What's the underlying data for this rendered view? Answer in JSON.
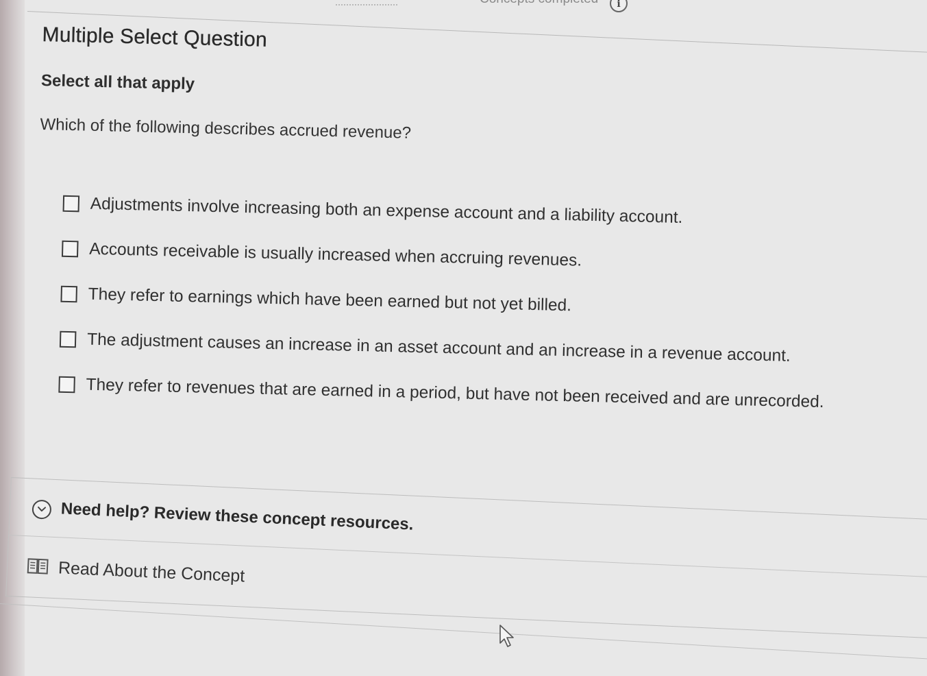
{
  "header": {
    "status_text": "Concepts completed",
    "info_label": "i"
  },
  "question": {
    "type_label": "Multiple Select Question",
    "instruction": "Select all that apply",
    "prompt": "Which of the following describes accrued revenue?",
    "options": [
      {
        "label": "Adjustments involve increasing both an expense account and a liability account.",
        "checked": false
      },
      {
        "label": "Accounts receivable is usually increased when accruing revenues.",
        "checked": false
      },
      {
        "label": "They refer to earnings which have been earned but not yet billed.",
        "checked": false
      },
      {
        "label": "The adjustment causes an increase in an asset account and an increase in a revenue account.",
        "checked": false
      },
      {
        "label": "They refer to revenues that are earned in a period, but have not been received and are unrecorded.",
        "checked": false
      }
    ]
  },
  "help": {
    "title": "Need help? Review these concept resources.",
    "expand_icon": "chevron-down-icon",
    "resources": [
      {
        "label": "Read About the Concept",
        "icon": "book-icon"
      }
    ]
  }
}
